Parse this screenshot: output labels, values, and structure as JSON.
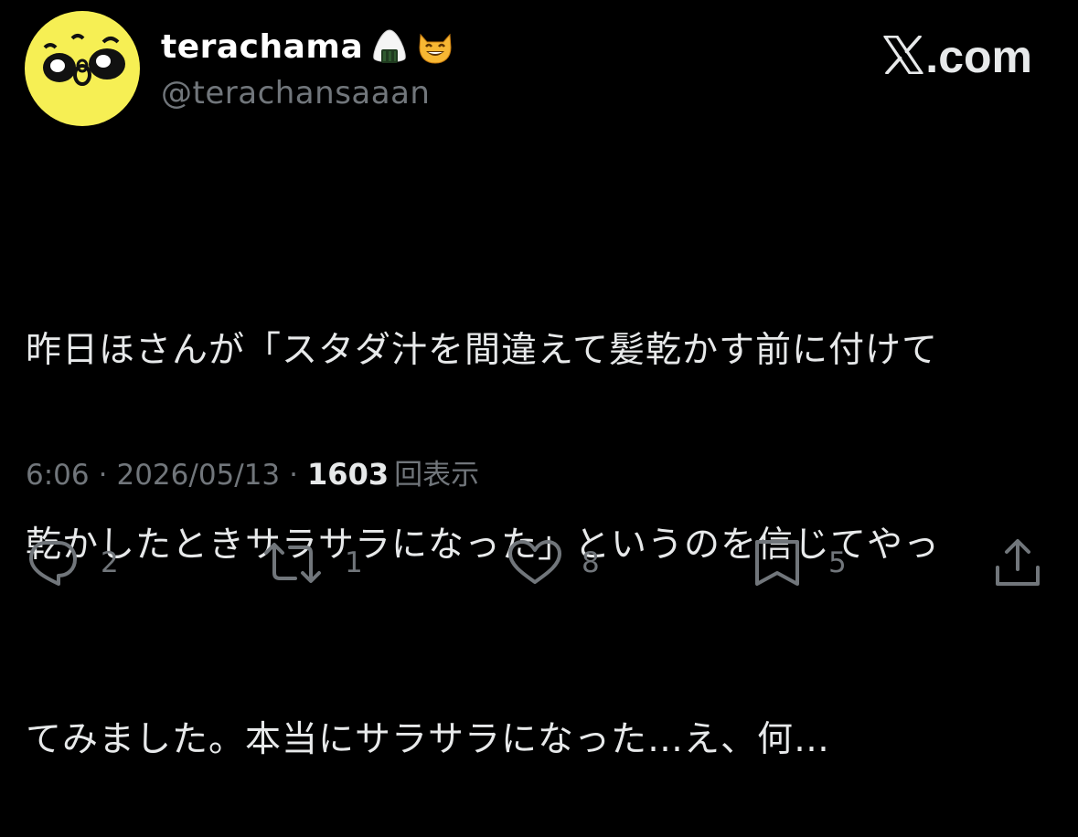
{
  "author": {
    "display_name": "terachama",
    "handle": "@terachansaaan",
    "avatar_bg": "#f6ef54",
    "name_emojis": [
      "onigiri-icon",
      "grinning-cat-icon"
    ]
  },
  "brand": {
    "text": ".com",
    "logo": "x-logo-icon"
  },
  "tweet": {
    "lines": [
      "昨日ほさんが「スタダ汁を間違えて髪乾かす前に付けて",
      "乾かしたときサラサラになった」というのを信じてやっ",
      "てみました。本当にサラサラになった…え、何…"
    ]
  },
  "meta": {
    "time": "6:06",
    "separator": "·",
    "date": "2026/05/13",
    "views_count": "1603",
    "views_label": "回表示"
  },
  "actions": {
    "reply_count": "2",
    "repost_count": "1",
    "like_count": "8",
    "bookmark_count": "5"
  },
  "colors": {
    "background": "#000000",
    "text": "#e7e9ea",
    "secondary": "#71767b"
  }
}
